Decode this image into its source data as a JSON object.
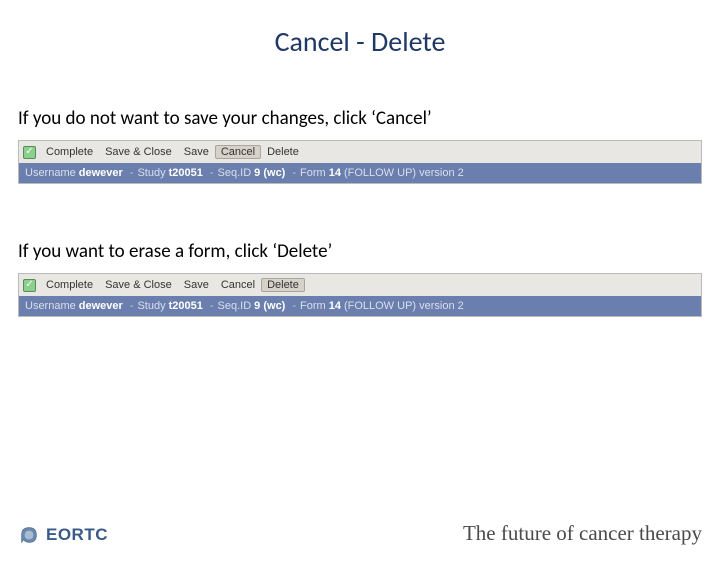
{
  "title": "Cancel - Delete",
  "instruction_cancel": "If you do not want to save your changes, click ‘Cancel’",
  "instruction_delete": "If you want to erase a form, click ‘Delete’",
  "toolbar": {
    "complete": "Complete",
    "save_close": "Save & Close",
    "save": "Save",
    "cancel": "Cancel",
    "delete": "Delete"
  },
  "statusbar": {
    "username_label": "Username",
    "username_value": "dewever",
    "study_label": "Study",
    "study_value": "t20051",
    "seqid_label": "Seq.ID",
    "seqid_value": "9 (wc)",
    "form_label": "Form",
    "form_value": "14",
    "form_extra": "(FOLLOW UP) version 2"
  },
  "footer": {
    "logo_text": "EORTC",
    "tagline": "The future of cancer therapy"
  }
}
